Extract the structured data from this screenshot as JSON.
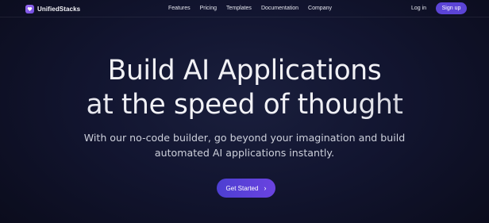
{
  "nav": {
    "brand": "UnifiedStacks",
    "links": [
      "Features",
      "Pricing",
      "Templates",
      "Documentation",
      "Company"
    ],
    "login": "Log in",
    "signup": "Sign up"
  },
  "hero": {
    "title_line1": "Build AI Applications",
    "title_line2": "at the speed of thought",
    "subtitle_line1": "With our no-code builder, go beyond your imagination and build",
    "subtitle_line2": "automated AI applications instantly.",
    "cta_label": "Get Started",
    "cta_icon": "chevron-right-icon"
  },
  "colors": {
    "accent": "#5b44d6",
    "background": "#121530"
  }
}
